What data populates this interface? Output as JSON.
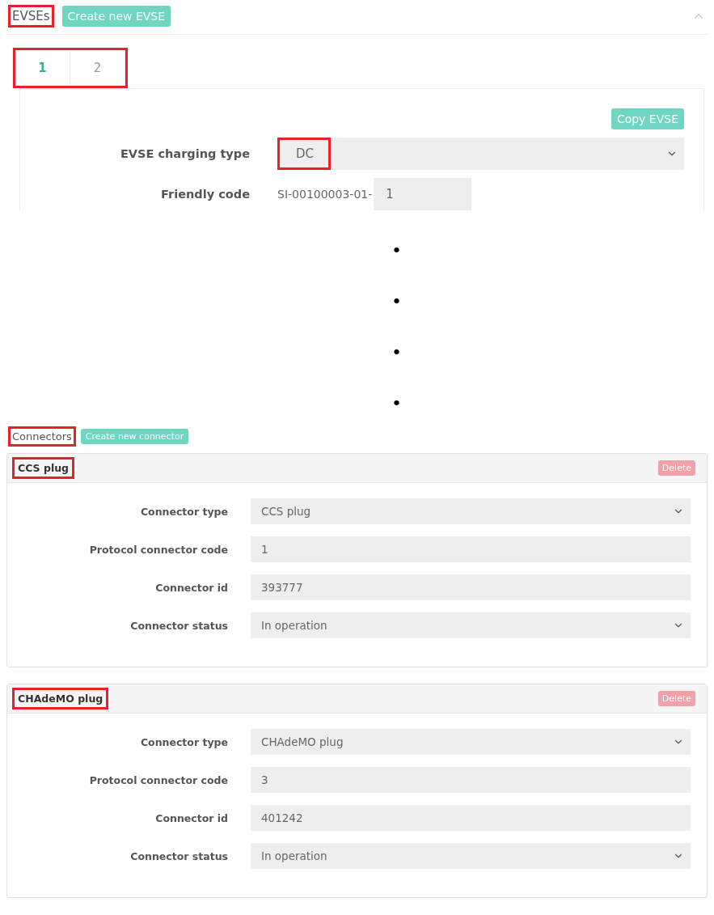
{
  "evses": {
    "title": "EVSEs",
    "title_highlighted": true,
    "create_button": "Create new EVSE",
    "expanded": true,
    "tabs": [
      {
        "label": "1",
        "selected": true
      },
      {
        "label": "2",
        "selected": false
      }
    ],
    "tabs_highlighted": true,
    "copy_button": "Copy EVSE",
    "fields": [
      {
        "kind": "select",
        "label": "EVSE charging type",
        "value": "DC",
        "highlighted": true
      },
      {
        "kind": "prefixed",
        "label": "Friendly code",
        "prefix": "SI-00100003-01-",
        "value": "1"
      }
    ]
  },
  "gap_marks": [
    "•",
    "•",
    "•",
    "•"
  ],
  "connectors": {
    "title": "Connectors",
    "title_highlighted": true,
    "create_button": "Create new connector",
    "items": [
      {
        "name": "CCS plug",
        "name_highlighted": true,
        "delete_button": "Delete",
        "fields": [
          {
            "kind": "select",
            "label": "Connector type",
            "value": "CCS plug"
          },
          {
            "kind": "input",
            "label": "Protocol connector code",
            "value": "1"
          },
          {
            "kind": "input",
            "label": "Connector id",
            "value": "393777"
          },
          {
            "kind": "select",
            "label": "Connector status",
            "value": "In operation"
          }
        ]
      },
      {
        "name": "CHAdeMO plug",
        "name_highlighted": true,
        "delete_button": "Delete",
        "fields": [
          {
            "kind": "select",
            "label": "Connector type",
            "value": "CHAdeMO plug"
          },
          {
            "kind": "input",
            "label": "Protocol connector code",
            "value": "3"
          },
          {
            "kind": "input",
            "label": "Connector id",
            "value": "401242"
          },
          {
            "kind": "select",
            "label": "Connector status",
            "value": "In operation"
          }
        ]
      }
    ]
  }
}
